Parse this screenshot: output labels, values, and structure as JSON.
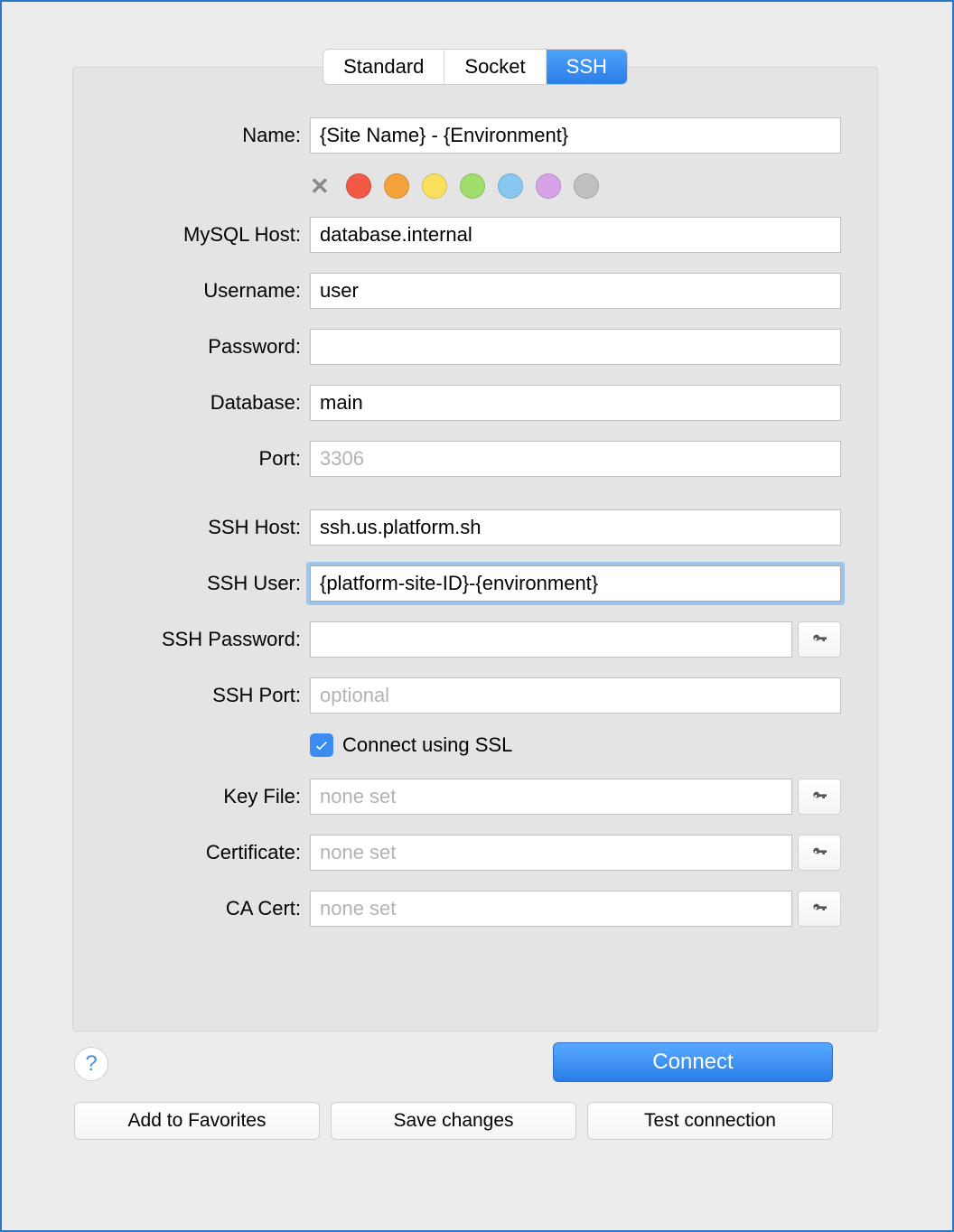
{
  "tabs": {
    "standard": "Standard",
    "socket": "Socket",
    "ssh": "SSH"
  },
  "labels": {
    "name": "Name:",
    "mysql_host": "MySQL Host:",
    "username": "Username:",
    "password": "Password:",
    "database": "Database:",
    "port": "Port:",
    "ssh_host": "SSH Host:",
    "ssh_user": "SSH User:",
    "ssh_password": "SSH Password:",
    "ssh_port": "SSH Port:",
    "key_file": "Key File:",
    "certificate": "Certificate:",
    "ca_cert": "CA Cert:"
  },
  "fields": {
    "name": "{Site Name} - {Environment}",
    "mysql_host": "database.internal",
    "username": "user",
    "password": "",
    "database": "main",
    "port": "",
    "port_placeholder": "3306",
    "ssh_host": "ssh.us.platform.sh",
    "ssh_user": "{platform-site-ID}-{environment}",
    "ssh_password": "",
    "ssh_port": "",
    "ssh_port_placeholder": "optional",
    "key_file": "",
    "key_file_placeholder": "none set",
    "certificate": "",
    "certificate_placeholder": "none set",
    "ca_cert": "",
    "ca_cert_placeholder": "none set"
  },
  "ssl_checkbox_label": "Connect using SSL",
  "colors": [
    "#f15a45",
    "#f3a23c",
    "#f9e15e",
    "#9fde6d",
    "#88c7f0",
    "#d7a2e8",
    "#c0c0c0"
  ],
  "buttons": {
    "help": "?",
    "connect": "Connect",
    "favorites": "Add to Favorites",
    "save": "Save changes",
    "test": "Test connection"
  }
}
